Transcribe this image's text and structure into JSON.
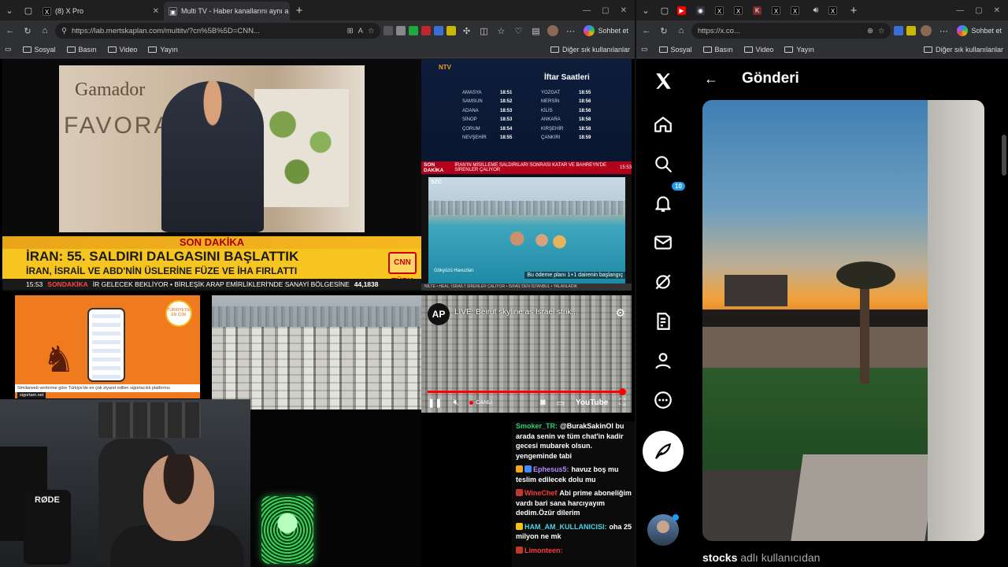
{
  "left_window": {
    "tabs": [
      {
        "label": "(8) X Pro",
        "favicon": "x-icon",
        "active": false
      },
      {
        "label": "Multi TV - Haber kanallarını aynı a",
        "favicon": "multitv-icon",
        "active": true
      }
    ],
    "address": "https://lab.mertskaplan.com/multitv/?cn%5B%5D=CNN...",
    "copilot_label": "Sohbet et",
    "bookmarks": [
      "Sosyal",
      "Basın",
      "Video",
      "Yayın"
    ],
    "other_bookmarks": "Diğer sık kullanılanlar"
  },
  "tv1": {
    "brand_line1": "Gamador",
    "brand_line2": "FAVORA",
    "son_dakika": "SON DAKİKA",
    "headline": "İRAN: 55. SALDIRI DALGASINI BAŞLATTIK",
    "subheadline": "İRAN, İSRAİL VE ABD'NİN ÜSLERİNE FÜZE VE İHA FIRLATTI",
    "channel": "CNN TÜRK",
    "ticker_time": "15:53",
    "ticker_tag": "SONDAKİKA",
    "ticker_text": "İR GELECEK BEKLİYOR  •  BİRLEŞİK ARAP EMİRLİKLERİ'NDE SANAYİ BÖLGESİNE",
    "ticker_number": "44,1838"
  },
  "tv2": {
    "logo": "NTV",
    "title": "İftar Saatleri",
    "rows": [
      [
        "AMASYA",
        "18:51",
        "YOZGAT",
        "18:55"
      ],
      [
        "SAMSUN",
        "18:52",
        "MERSİN",
        "18:56"
      ],
      [
        "ADANA",
        "18:53",
        "KİLİS",
        "18:56"
      ],
      [
        "SİNOP",
        "18:53",
        "ANKARA",
        "18:58"
      ],
      [
        "ÇORUM",
        "18:54",
        "KIRŞEHİR",
        "18:58"
      ],
      [
        "NEVŞEHİR",
        "18:55",
        "ÇANKIRI",
        "18:59"
      ]
    ],
    "bar_tag": "SON DAKİKA",
    "bar_text": "İRAN'IN MİSİLLEME SALDIRILARI SONRASI KATAR VE BAHREYN'DE SİRENLER ÇALIYOR",
    "bar_time": "15:53"
  },
  "tv3": {
    "logo": "SZC",
    "caption": "Gökyüzü Havuzları",
    "promo": "Bu ödeme planı 1+1 dairenin başlangıç",
    "bottom_ticker": "NİLTE  •  HEAL: İSRAİL'İ SİRENLER ÇALIYOR  •  İSRAİL'DEN İSTANBUL  •  YALANLADIK"
  },
  "tv4": {
    "badge": "TÜRKİYE'DE EN ÇOK",
    "ticker": "Similarweb verilerine göre Türkiye'de en çok ziyaret edilen sigortacılık platformu",
    "url": "sigortam.net"
  },
  "tv6": {
    "logo": "AP",
    "title": "LIVE: Beirut skyline as Israel strik...",
    "live_label": "CANLI",
    "brand": "YouTube",
    "progress": 0.985
  },
  "cam": {
    "mic_brand": "RØDE"
  },
  "chat": {
    "messages": [
      {
        "user": "Smoker_TR:",
        "color": "#2ecc71",
        "text": "@BurakSakinOl bu arada senin ve tüm chat'in kadir gecesi mubarek olsun. yengeminde tabi",
        "badges": []
      },
      {
        "user": "Ephesus5:",
        "color": "#b388ff",
        "text": "havuz boş mu teslim edilecek dolu mu",
        "badges": [
          "#f5a623",
          "#3d8bfd"
        ]
      },
      {
        "user": "WineChef",
        "color": "#ff3b3b",
        "text": "Abi prime aboneliğim vardı bari sana harcıyayım dedim.Özür dilerim",
        "badges": [
          "#c0392b"
        ]
      },
      {
        "user": "HAM_AM_KULLANICISI:",
        "color": "#4dd0e1",
        "text": "oha 25 milyon ne mk",
        "badges": [
          "#f1c40f"
        ]
      },
      {
        "user": "Limonteen:",
        "color": "#ff3b3b",
        "text": "",
        "badges": [
          "#c0392b"
        ]
      }
    ]
  },
  "right_window": {
    "address": "https://x.co...",
    "copilot_label": "Sohbet et",
    "bookmarks": [
      "Sosyal",
      "Basın",
      "Video",
      "Yayın"
    ],
    "other_bookmarks": "Diğer sık kullanılanlar",
    "nav": [
      "x-logo-icon",
      "home-icon",
      "search-icon",
      "notifications-icon",
      "messages-icon",
      "grok-icon",
      "lists-icon",
      "profile-icon",
      "more-icon"
    ],
    "notification_count": "10",
    "header_title": "Gönderi",
    "footer_user": "stocks",
    "footer_suffix": "adlı kullanıcıdan"
  }
}
